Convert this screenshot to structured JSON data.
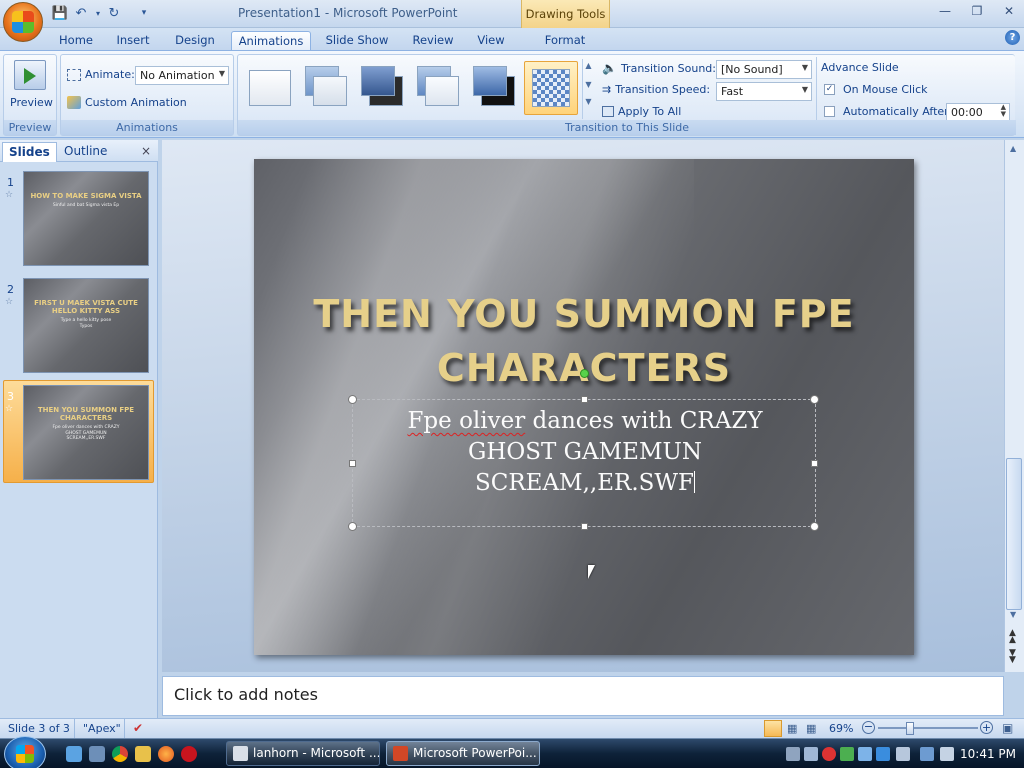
{
  "window": {
    "title": "Presentation1 - Microsoft PowerPoint",
    "context_group": "Drawing Tools"
  },
  "tabs": [
    "Home",
    "Insert",
    "Design",
    "Animations",
    "Slide Show",
    "Review",
    "View",
    "Format"
  ],
  "ribbon": {
    "preview_label": "Preview",
    "preview_group": "Preview",
    "animate_label": "Animate:",
    "animate_value": "No Animation",
    "custom_animation": "Custom Animation",
    "animations_group": "Animations",
    "transition_group": "Transition to This Slide",
    "transition_sound_label": "Transition Sound:",
    "transition_sound_value": "[No Sound]",
    "transition_speed_label": "Transition Speed:",
    "transition_speed_value": "Fast",
    "apply_to_all": "Apply To All",
    "advance_slide": "Advance Slide",
    "on_mouse_click": "On Mouse Click",
    "on_mouse_click_checked": true,
    "automatically_after": "Automatically After:",
    "automatically_after_checked": false,
    "auto_time": "00:00"
  },
  "pane": {
    "tabs": [
      "Slides",
      "Outline"
    ],
    "slides": [
      {
        "num": "1",
        "title": "HOW TO MAKE SIGMA VISTA",
        "body": [
          "Sinful and bat Sigma vista Ep"
        ]
      },
      {
        "num": "2",
        "title": "FIRST U MAEK VISTA CUTE HELLO KITTY ASS",
        "body": [
          "Type a hello kitty pose",
          "Typos"
        ]
      },
      {
        "num": "3",
        "title": "THEN YOU SUMMON FPE CHARACTERS",
        "body": [
          "Fpe oliver dances with CRAZY",
          "GHOST GAMEMUN",
          "SCREAM,,ER.SWF"
        ]
      }
    ]
  },
  "slide": {
    "title_lines": [
      "THEN YOU SUMMON FPE",
      "CHARACTERS"
    ],
    "body_line1_underlined": "Fpe oliver",
    "body_line1_rest": " dances with CRAZY",
    "body_line2": "GHOST GAMEMUN",
    "body_line3": "SCREAM,,ER.SWF"
  },
  "notes_placeholder": "Click to add notes",
  "status": {
    "slide_indicator": "Slide 3 of 3",
    "theme": "\"Apex\"",
    "zoom": "69%"
  },
  "taskbar": {
    "buttons": [
      "lanhorn - Microsoft ...",
      "Microsoft PowerPoi..."
    ],
    "clock": "10:41 PM"
  },
  "colors": {
    "ribbon_blue": "#15428b",
    "title_gold": "#e6d08a",
    "selected_orange": "#f6b04a"
  }
}
